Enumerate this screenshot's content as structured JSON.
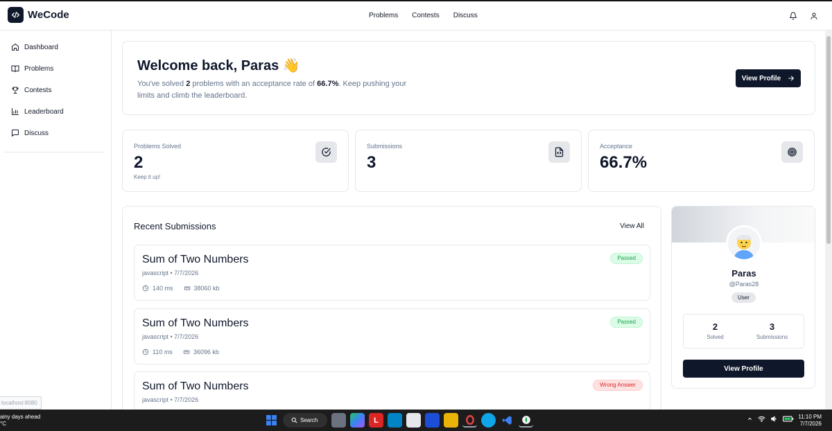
{
  "app": {
    "name": "WeCode"
  },
  "topnav": {
    "problems": "Problems",
    "contests": "Contests",
    "discuss": "Discuss"
  },
  "sidebar": {
    "items": [
      {
        "label": "Dashboard",
        "icon": "home-icon"
      },
      {
        "label": "Problems",
        "icon": "book-icon"
      },
      {
        "label": "Contests",
        "icon": "trophy-icon"
      },
      {
        "label": "Leaderboard",
        "icon": "bar-chart-icon"
      },
      {
        "label": "Discuss",
        "icon": "message-icon"
      }
    ]
  },
  "url_hint": "localhost:8080",
  "welcome": {
    "title": "Welcome back, Paras 👋",
    "text_prefix": "You've solved ",
    "solved": "2",
    "text_mid": " problems with an acceptance rate of ",
    "rate": "66.7%",
    "text_suffix": ". Keep pushing your limits and climb the leaderboard.",
    "button": "View Profile"
  },
  "stats": [
    {
      "label": "Problems Solved",
      "value": "2",
      "sub": "Keep it up!",
      "icon": "check-circle-icon"
    },
    {
      "label": "Submissions",
      "value": "3",
      "sub": "",
      "icon": "file-code-icon"
    },
    {
      "label": "Acceptance",
      "value": "66.7%",
      "sub": "",
      "icon": "target-icon"
    }
  ],
  "recent": {
    "title": "Recent Submissions",
    "view_all": "View All",
    "items": [
      {
        "title": "Sum of Two Numbers",
        "meta": "javascript • 7/7/2026",
        "time": "140 ms",
        "memory": "38060 kb",
        "status": "Passed"
      },
      {
        "title": "Sum of Two Numbers",
        "meta": "javascript • 7/7/2026",
        "time": "110 ms",
        "memory": "36096 kb",
        "status": "Passed"
      },
      {
        "title": "Sum of Two Numbers",
        "meta": "javascript • 7/7/2026",
        "time": "",
        "memory": "",
        "status": "Wrong Answer"
      }
    ]
  },
  "profile": {
    "name": "Paras",
    "handle": "@Paras28",
    "role": "User",
    "solved": "2",
    "solved_label": "Solved",
    "submissions": "3",
    "submissions_label": "Submissions",
    "button": "View Profile"
  },
  "taskbar": {
    "weather_line1": "ainy days ahead",
    "weather_line2": "°C",
    "search": "Search",
    "time": "11:10 PM",
    "date": "7/7/2026"
  },
  "colors": {
    "primary": "#0f172a",
    "muted": "#64748b",
    "pass": "#16a34a",
    "fail": "#dc2626",
    "border": "#e5e7eb"
  }
}
